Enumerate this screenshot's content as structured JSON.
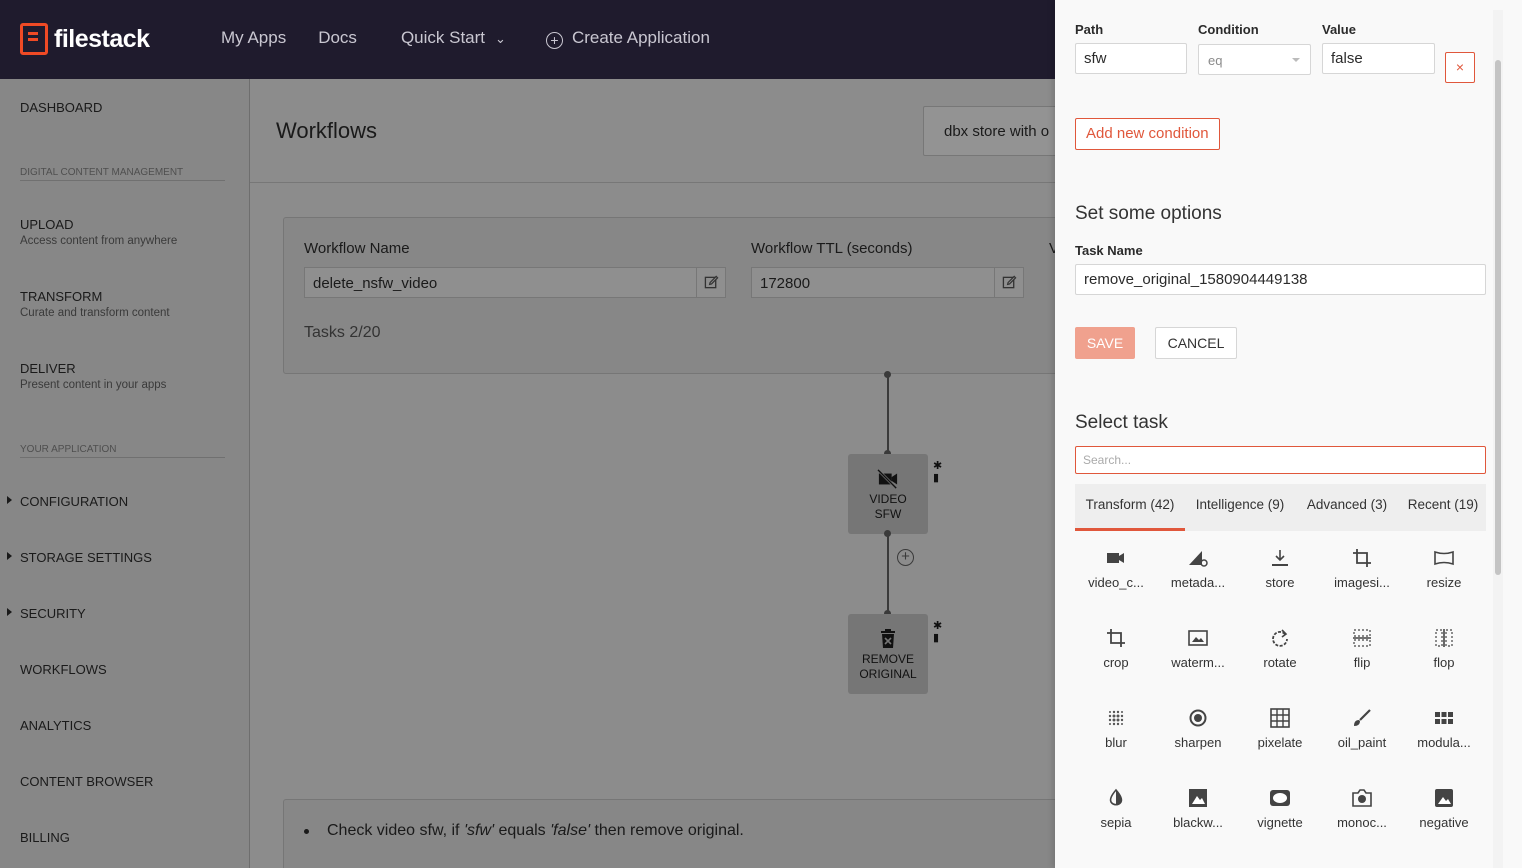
{
  "header": {
    "logo_text": "filestack",
    "nav": {
      "my_apps": "My Apps",
      "docs": "Docs",
      "quick_start": "Quick Start",
      "create_application": "Create Application"
    }
  },
  "sidebar": {
    "dashboard": "DASHBOARD",
    "section_dcm": "DIGITAL CONTENT MANAGEMENT",
    "upload": {
      "label": "UPLOAD",
      "sub": "Access content from anywhere"
    },
    "transform": {
      "label": "TRANSFORM",
      "sub": "Curate and transform content"
    },
    "deliver": {
      "label": "DELIVER",
      "sub": "Present content in your apps"
    },
    "section_app": "YOUR APPLICATION",
    "configuration": "CONFIGURATION",
    "storage_settings": "STORAGE SETTINGS",
    "security": "SECURITY",
    "workflows": "WORKFLOWS",
    "analytics": "ANALYTICS",
    "content_browser": "CONTENT BROWSER",
    "billing": "BILLING"
  },
  "main": {
    "title": "Workflows",
    "workflow_select": "dbx store with o",
    "workflow_name_label": "Workflow Name",
    "workflow_name_value": "delete_nsfw_video",
    "workflow_ttl_label": "Workflow TTL (seconds)",
    "workflow_ttl_value": "172800",
    "third_label_fragment": "V",
    "tasks_count": "Tasks 2/20",
    "nodes": [
      {
        "label_1": "VIDEO",
        "label_2": "SFW",
        "icon": "videocam-off-icon"
      },
      {
        "label_1": "REMOVE",
        "label_2": "ORIGINAL",
        "icon": "delete-forever-icon"
      }
    ],
    "note": {
      "prefix": "Check video sfw, if ",
      "path": "'sfw'",
      "middle": " equals ",
      "value": "'false'",
      "suffix": " then remove original."
    }
  },
  "panel": {
    "path_label": "Path",
    "path_value": "sfw",
    "condition_label": "Condition",
    "condition_value": "eq",
    "value_label": "Value",
    "value_value": "false",
    "remove_condition": "×",
    "add_condition": "Add new condition",
    "options_heading": "Set some options",
    "task_name_label": "Task Name",
    "task_name_value": "remove_original_1580904449138",
    "save": "SAVE",
    "cancel": "CANCEL",
    "select_task_heading": "Select task",
    "search_placeholder": "Search...",
    "tabs": [
      "Transform (42)",
      "Intelligence (9)",
      "Advanced (3)",
      "Recent (19)"
    ],
    "active_tab": "Transform (42)",
    "tasks": [
      {
        "label": "video_c...",
        "icon": "videocam-icon"
      },
      {
        "label": "metada...",
        "icon": "metadata-icon"
      },
      {
        "label": "store",
        "icon": "download-icon"
      },
      {
        "label": "imagesi...",
        "icon": "crop-icon"
      },
      {
        "label": "resize",
        "icon": "panorama-icon"
      },
      {
        "label": "crop",
        "icon": "crop-icon"
      },
      {
        "label": "waterm...",
        "icon": "watermark-icon"
      },
      {
        "label": "rotate",
        "icon": "rotate-icon"
      },
      {
        "label": "flip",
        "icon": "flip-icon"
      },
      {
        "label": "flop",
        "icon": "flop-icon"
      },
      {
        "label": "blur",
        "icon": "blur-icon"
      },
      {
        "label": "sharpen",
        "icon": "sharpen-icon"
      },
      {
        "label": "pixelate",
        "icon": "grid-icon"
      },
      {
        "label": "oil_paint",
        "icon": "brush-icon"
      },
      {
        "label": "modula...",
        "icon": "modulate-icon"
      },
      {
        "label": "sepia",
        "icon": "contrast-icon"
      },
      {
        "label": "blackw...",
        "icon": "blackwhite-icon"
      },
      {
        "label": "vignette",
        "icon": "vignette-icon"
      },
      {
        "label": "monoc...",
        "icon": "camera-icon"
      },
      {
        "label": "negative",
        "icon": "image-icon"
      }
    ]
  },
  "colors": {
    "accent": "#e0573b",
    "header_bg": "#1f1b2d",
    "panel_bg": "#f9f9f9"
  }
}
